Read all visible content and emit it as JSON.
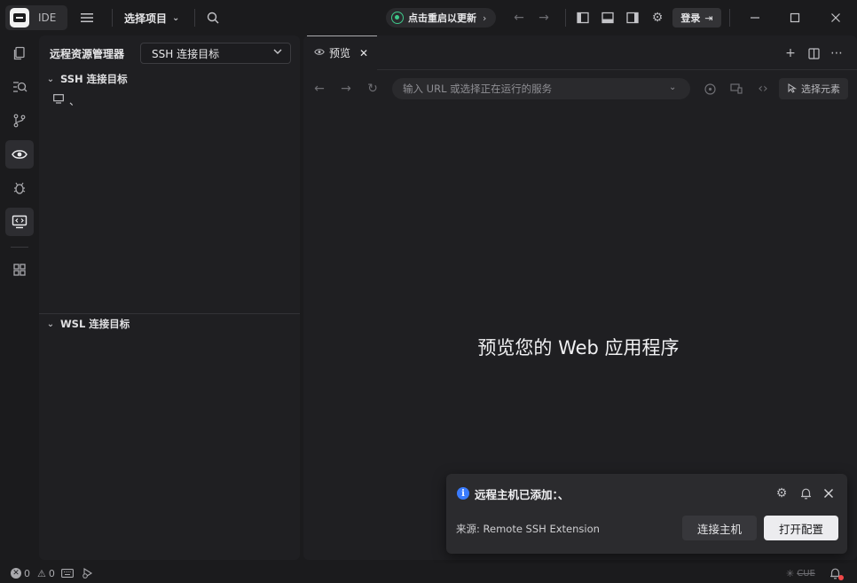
{
  "titlebar": {
    "logo_text": "IDE",
    "project_selector": "选择项目",
    "update_label": "点击重启以更新",
    "login_label": "登录"
  },
  "sidebar": {
    "title": "远程资源管理器",
    "select_value": "SSH 连接目标",
    "ssh_section": "SSH 连接目标",
    "ssh_item": "、",
    "wsl_section": "WSL 连接目标"
  },
  "editor": {
    "tab_label": "预览",
    "url_placeholder": "输入 URL 或选择正在运行的服务",
    "pick_element": "选择元素",
    "preview_heading": "预览您的 Web 应用程序"
  },
  "notification": {
    "title": "远程主机已添加：、",
    "source": "来源: Remote SSH Extension",
    "secondary_button": "连接主机",
    "primary_button": "打开配置"
  },
  "statusbar": {
    "errors": "0",
    "warnings": "0"
  },
  "colors": {
    "accent_info": "#3a7bfd",
    "update_green": "#3ec98a",
    "notification_dot": "#f04848"
  }
}
